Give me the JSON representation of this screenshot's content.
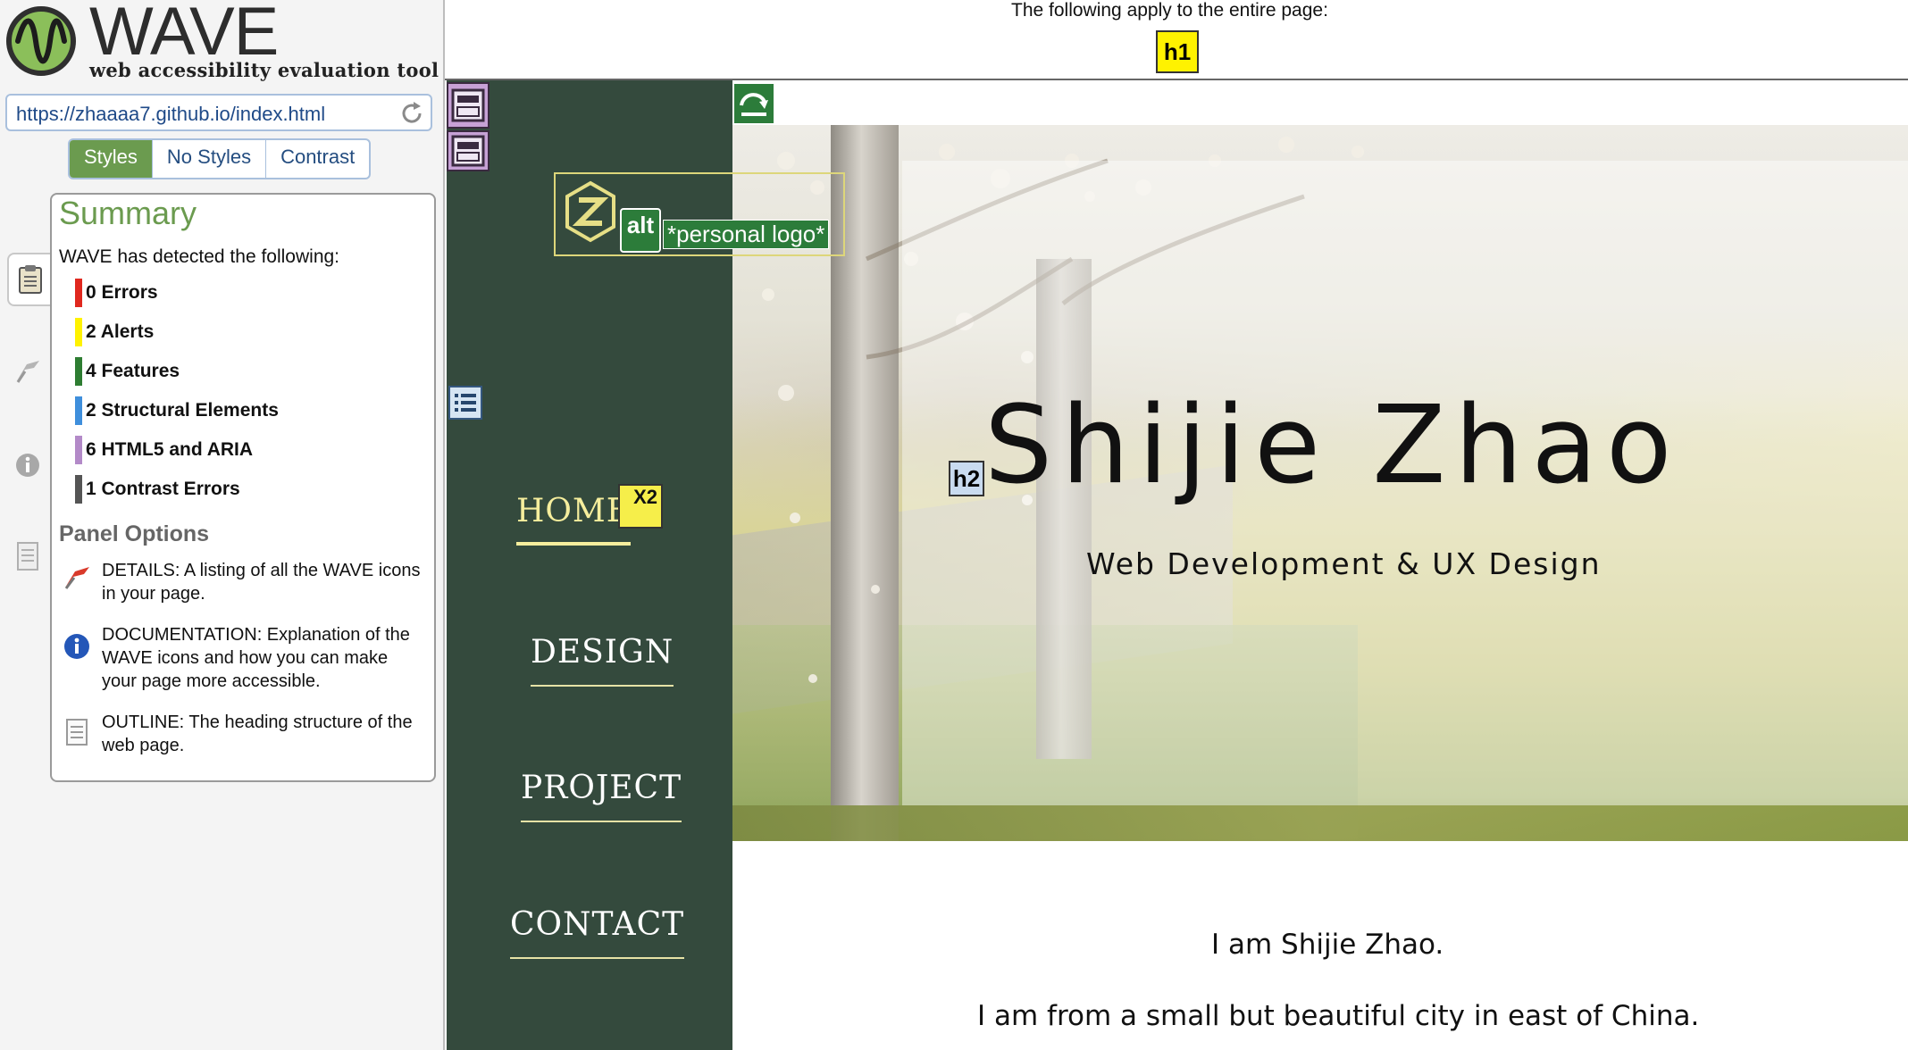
{
  "wave": {
    "title": "WAVE",
    "subtitle": "web accessibility evaluation tool",
    "url": "https://zhaaaa7.github.io/index.html",
    "tabs": [
      {
        "label": "Styles",
        "active": true
      },
      {
        "label": "No Styles",
        "active": false
      },
      {
        "label": "Contrast",
        "active": false
      }
    ],
    "summary": {
      "title": "Summary",
      "detected_text": "WAVE has detected the following:",
      "counts": [
        {
          "label": "0 Errors",
          "color": "#e0281f"
        },
        {
          "label": "2 Alerts",
          "color": "#fff200"
        },
        {
          "label": "4 Features",
          "color": "#2e7d32"
        },
        {
          "label": "2 Structural Elements",
          "color": "#3f8fdc"
        },
        {
          "label": "6 HTML5 and ARIA",
          "color": "#b38ac8"
        },
        {
          "label": "1 Contrast Errors",
          "color": "#555555"
        }
      ],
      "panel_options_title": "Panel Options",
      "options": [
        {
          "icon": "details-flag-icon",
          "text": "DETAILS: A listing of all the WAVE icons in your page."
        },
        {
          "icon": "info-icon",
          "text": "DOCUMENTATION: Explanation of the WAVE icons and how you can make your page more accessible."
        },
        {
          "icon": "outline-document-icon",
          "text": "OUTLINE: The heading structure of the web page."
        }
      ]
    },
    "toplevel_text": "The following apply to the entire page:",
    "annotations": {
      "h1": "h1",
      "h2": "h2",
      "alt": "alt",
      "alt_text": "*personal logo*",
      "x2": "X2"
    }
  },
  "site": {
    "nav": [
      {
        "label": "HOME",
        "active": true
      },
      {
        "label": "DESIGN",
        "active": false
      },
      {
        "label": "PROJECT",
        "active": false
      },
      {
        "label": "CONTACT",
        "active": false
      }
    ],
    "hero_name": "Shijie Zhao",
    "hero_tagline": "Web Development & UX Design",
    "intro": [
      "I am Shijie Zhao.",
      "I am from a small but beautiful city in east of China."
    ],
    "nav_bg": "#344a3d",
    "accent": "#f6ee9d"
  }
}
